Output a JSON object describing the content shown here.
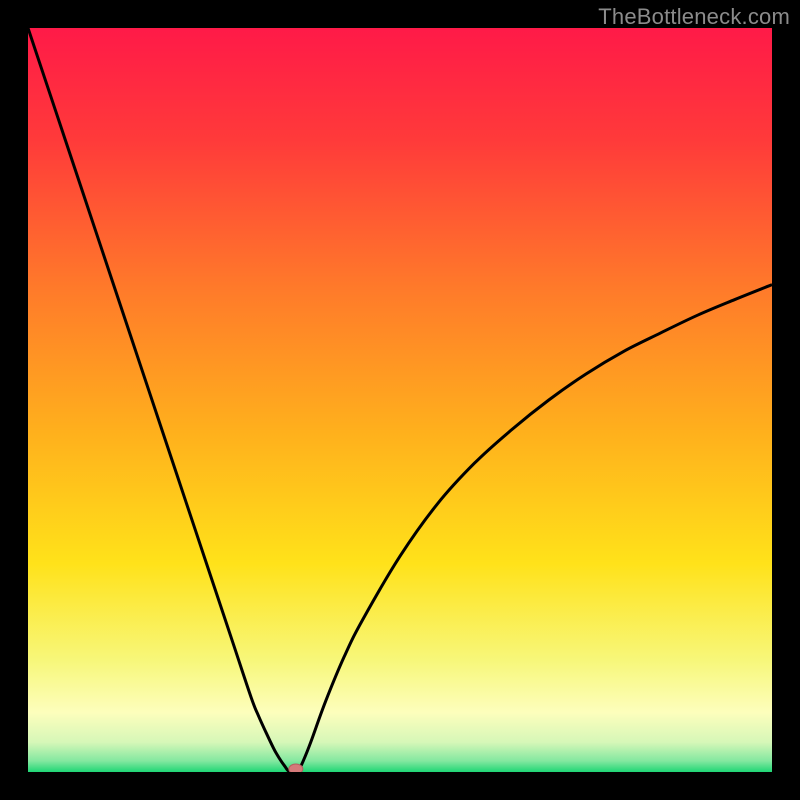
{
  "watermark": "TheBottleneck.com",
  "colors": {
    "frame": "#000000",
    "curve": "#000000",
    "marker_fill": "#d57a7a",
    "marker_stroke": "#b46060",
    "gradient_stops": [
      {
        "offset": 0.0,
        "color": "#ff1a48"
      },
      {
        "offset": 0.15,
        "color": "#ff3a3a"
      },
      {
        "offset": 0.35,
        "color": "#ff7a2a"
      },
      {
        "offset": 0.55,
        "color": "#ffb21c"
      },
      {
        "offset": 0.72,
        "color": "#ffe21a"
      },
      {
        "offset": 0.85,
        "color": "#f7f77a"
      },
      {
        "offset": 0.92,
        "color": "#fdfebc"
      },
      {
        "offset": 0.96,
        "color": "#d6f7b8"
      },
      {
        "offset": 0.985,
        "color": "#84e8a0"
      },
      {
        "offset": 1.0,
        "color": "#1fd675"
      }
    ]
  },
  "chart_data": {
    "type": "line",
    "title": "",
    "xlabel": "",
    "ylabel": "",
    "xlim": [
      0,
      100
    ],
    "ylim": [
      0,
      100
    ],
    "x_min_at": 35,
    "marker": {
      "x": 36,
      "y": 0
    },
    "series": [
      {
        "name": "curve",
        "x": [
          0,
          2.5,
          5,
          7.5,
          10,
          12.5,
          15,
          17.5,
          20,
          22.5,
          25,
          27.5,
          30,
          31,
          32,
          33,
          33.5,
          34,
          34.5,
          35,
          35.5,
          36,
          36.5,
          37,
          38,
          40,
          42.5,
          45,
          50,
          55,
          60,
          65,
          70,
          75,
          80,
          85,
          90,
          95,
          100
        ],
        "y": [
          100,
          92.5,
          85,
          77.5,
          70,
          62.5,
          55,
          47.5,
          40,
          32.5,
          25,
          17.5,
          10,
          7.5,
          5.3,
          3.2,
          2.3,
          1.5,
          0.8,
          0.15,
          0.1,
          0.1,
          0.5,
          1.5,
          4,
          9.5,
          15.5,
          20.5,
          29,
          36,
          41.5,
          46,
          50,
          53.5,
          56.5,
          59,
          61.4,
          63.5,
          65.5
        ]
      }
    ]
  }
}
